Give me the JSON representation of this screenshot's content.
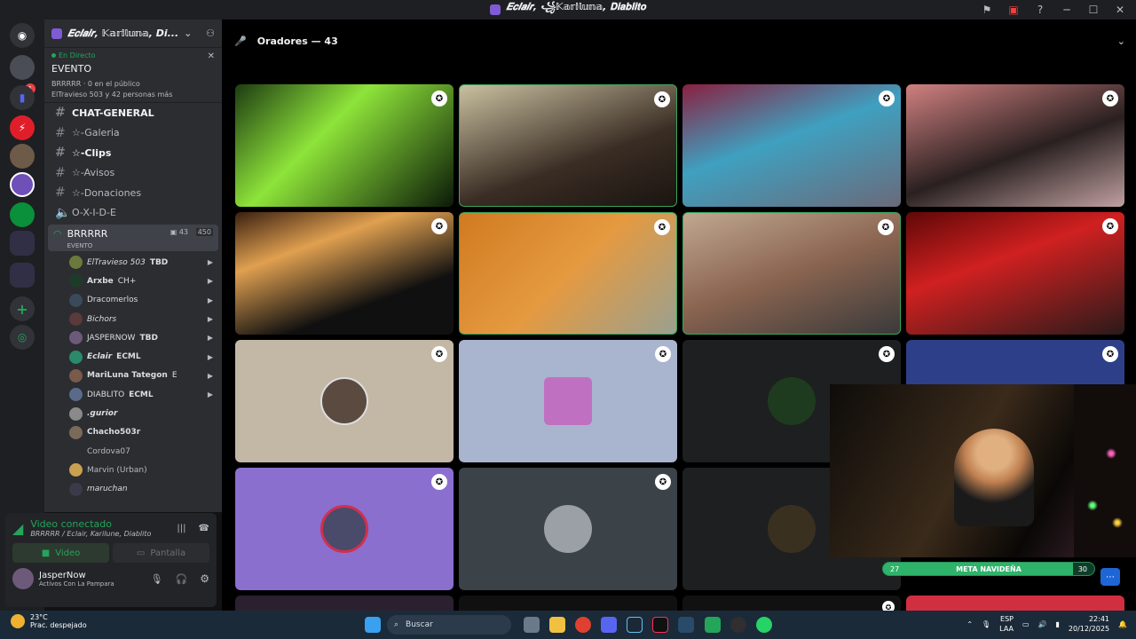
{
  "window": {
    "title": "𝑬𝒄𝒍𝒂𝒊𝒓, ꧁𝕂𝕒𝕣𝕚𝕝𝕦𝕟𝕒, 𝐃𝐢𝐚𝐛𝐥𝐢𝐭𝐨"
  },
  "server": {
    "name": "𝑬𝒄𝒍𝒂𝒊𝒓, 𝕂𝕒𝕣𝕚𝕝𝕦𝕟𝕒, Di...",
    "badge": "1"
  },
  "event": {
    "live_label": "En Directo",
    "name": "EVENTO",
    "host_line": "BRRRRR · 0 en el público",
    "attendees": "ElTravieso 503 y 42 personas más"
  },
  "channels": [
    {
      "name": "CHAT-GENERAL",
      "bold": true
    },
    {
      "name": "☆-Galeria",
      "bold": false
    },
    {
      "name": "☆-Clips",
      "bold": true
    },
    {
      "name": "☆-Avisos",
      "bold": false
    },
    {
      "name": "☆-Donaciones",
      "bold": false
    },
    {
      "name": "O-X-I-D-E",
      "bold": false
    }
  ],
  "voice_channel": {
    "name": "BRRRRR",
    "sub": "EVENTO",
    "cams": "43",
    "members": "450"
  },
  "members": [
    {
      "name": "ElTravieso 503",
      "tag": "TBD"
    },
    {
      "name": "Arxbe",
      "tag": "CH+"
    },
    {
      "name": "Dracomerlos",
      "tag": ""
    },
    {
      "name": "Bichors",
      "tag": ""
    },
    {
      "name": "JASPERNOW",
      "tag": "TBD"
    },
    {
      "name": "Eclair",
      "tag": "ECML"
    },
    {
      "name": "MariLuna Tategon",
      "tag": "E"
    },
    {
      "name": "DIABLITO",
      "tag": "ECML"
    },
    {
      "name": ".gurior",
      "tag": ""
    },
    {
      "name": "Chacho503r",
      "tag": ""
    },
    {
      "name": "Cordova07",
      "tag": ""
    },
    {
      "name": "Marvin (Urban)",
      "tag": ""
    },
    {
      "name": "maruchan",
      "tag": ""
    }
  ],
  "voice_status": {
    "title": "Video conectado",
    "subtitle": "BRRRRR / Eclair, Karilune, Diablito",
    "video_label": "Video",
    "screen_label": "Pantalla"
  },
  "user": {
    "name": "JasperNow",
    "status": "Activos Con La Pampara"
  },
  "stage": {
    "title": "Oradores — 43"
  },
  "pip": {
    "goal_label": "META NAVIDEÑA",
    "goal_left": "27",
    "goal_right": "30",
    "goal_progress": 0.9
  },
  "taskbar": {
    "temp": "23°C",
    "weather": "Prac. despejado",
    "search": "Buscar",
    "lang1": "ESP",
    "lang2": "LAA",
    "time": "22:41",
    "date": "20/12/2025"
  },
  "colors": {
    "accent": "#5865f2",
    "green": "#23a55a",
    "tile_purple": "#8a6fcf",
    "tile_slate": "#3b4248"
  }
}
